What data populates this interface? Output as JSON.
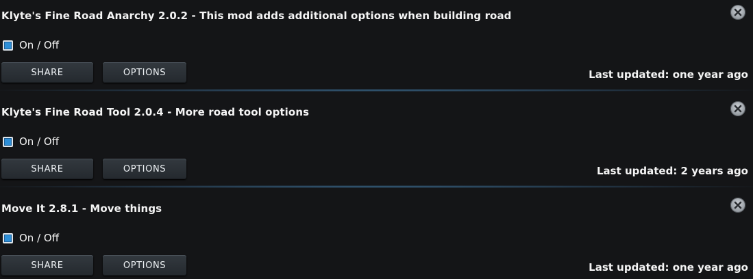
{
  "mods": [
    {
      "title": "Klyte's Fine Road Anarchy 2.0.2 - This mod adds additional options when building road",
      "toggle_label": "On / Off",
      "checked": true,
      "share_label": "SHARE",
      "options_label": "OPTIONS",
      "updated": "Last updated: one year ago"
    },
    {
      "title": "Klyte's Fine Road Tool 2.0.4 - More road tool options",
      "toggle_label": "On / Off",
      "checked": true,
      "share_label": "SHARE",
      "options_label": "OPTIONS",
      "updated": "Last updated: 2 years ago"
    },
    {
      "title": "Move It 2.8.1 - Move things",
      "toggle_label": "On / Off",
      "checked": true,
      "share_label": "SHARE",
      "options_label": "OPTIONS",
      "updated": "Last updated: one year ago"
    }
  ],
  "icons": {
    "close": "close-icon",
    "checkbox": "checkbox-icon"
  },
  "colors": {
    "background": "#141517",
    "checkbox_fill": "#2d8fd8",
    "button": "#2b3036",
    "divider": "#3a6a8d"
  }
}
